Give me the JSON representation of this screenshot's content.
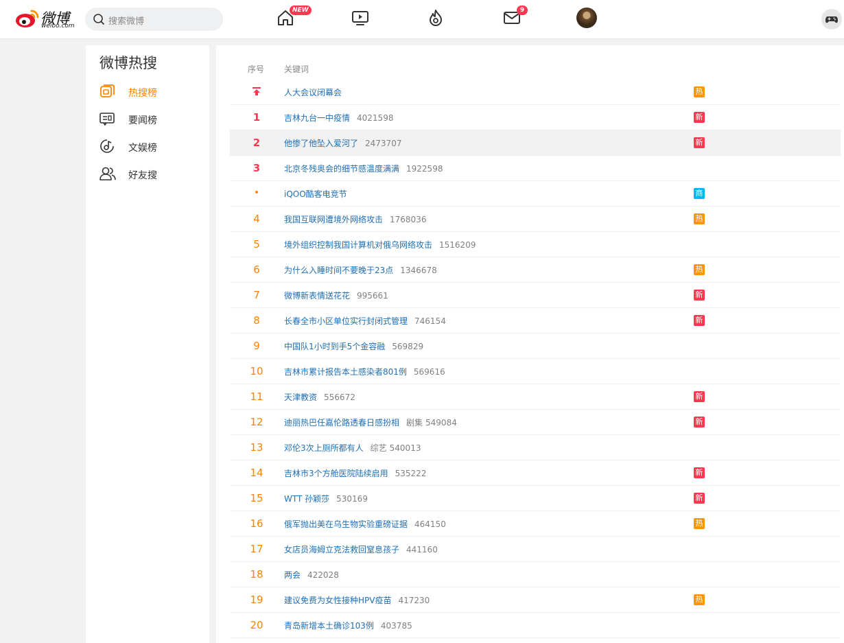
{
  "header": {
    "logo_text": "微博",
    "logo_sub": "weibo.com",
    "search_placeholder": "搜索微博",
    "nav": [
      {
        "icon": "home-icon",
        "badge": "NEW"
      },
      {
        "icon": "video-icon"
      },
      {
        "icon": "hot-flame-icon"
      },
      {
        "icon": "message-icon",
        "badge": "9"
      },
      {
        "icon": "avatar"
      }
    ],
    "badge_new": "NEW",
    "badge_msg": "9"
  },
  "sidebar": {
    "title": "微博热搜",
    "items": [
      {
        "label": "热搜榜",
        "icon": "hot-list-icon",
        "active": true
      },
      {
        "label": "要闻榜",
        "icon": "news-list-icon",
        "active": false
      },
      {
        "label": "文娱榜",
        "icon": "entertainment-icon",
        "active": false
      },
      {
        "label": "好友搜",
        "icon": "friends-icon",
        "active": false
      }
    ]
  },
  "table": {
    "col_rank": "序号",
    "col_keyword": "关键词"
  },
  "rows": [
    {
      "rank": "",
      "kw": "人大会议闭幕会",
      "cat": "",
      "num": "",
      "tag": "热",
      "tagType": "re",
      "rankType": "pin"
    },
    {
      "rank": "1",
      "kw": "吉林九台一中疫情",
      "cat": "",
      "num": "4021598",
      "tag": "新",
      "tagType": "xin",
      "rankType": "top"
    },
    {
      "rank": "2",
      "kw": "他惨了他坠入爱河了",
      "cat": "",
      "num": "2473707",
      "tag": "新",
      "tagType": "xin",
      "rankType": "top",
      "hl": true
    },
    {
      "rank": "3",
      "kw": "北京冬残奥会的细节感温度满满",
      "cat": "",
      "num": "1922598",
      "tag": "",
      "tagType": "",
      "rankType": "top"
    },
    {
      "rank": "•",
      "kw": "iQOO酷客电竞节",
      "cat": "",
      "num": "",
      "tag": "商",
      "tagType": "shang",
      "rankType": "ad"
    },
    {
      "rank": "4",
      "kw": "我国互联网遭境外网络攻击",
      "cat": "",
      "num": "1768036",
      "tag": "热",
      "tagType": "re",
      "rankType": "normal"
    },
    {
      "rank": "5",
      "kw": "境外组织控制我国计算机对俄乌网络攻击",
      "cat": "",
      "num": "1516209",
      "tag": "",
      "tagType": "",
      "rankType": "normal"
    },
    {
      "rank": "6",
      "kw": "为什么入睡时间不要晚于23点",
      "cat": "",
      "num": "1346678",
      "tag": "热",
      "tagType": "re",
      "rankType": "normal"
    },
    {
      "rank": "7",
      "kw": "微博新表情送花花",
      "cat": "",
      "num": "995661",
      "tag": "新",
      "tagType": "xin",
      "rankType": "normal"
    },
    {
      "rank": "8",
      "kw": "长春全市小区单位实行封闭式管理",
      "cat": "",
      "num": "746154",
      "tag": "新",
      "tagType": "xin",
      "rankType": "normal"
    },
    {
      "rank": "9",
      "kw": "中国队1小时到手5个金容融",
      "cat": "",
      "num": "569829",
      "tag": "",
      "tagType": "",
      "rankType": "normal"
    },
    {
      "rank": "10",
      "kw": "吉林市累计报告本土感染者801例",
      "cat": "",
      "num": "569616",
      "tag": "",
      "tagType": "",
      "rankType": "normal"
    },
    {
      "rank": "11",
      "kw": "天津教资",
      "cat": "",
      "num": "556672",
      "tag": "新",
      "tagType": "xin",
      "rankType": "normal"
    },
    {
      "rank": "12",
      "kw": "迪丽热巴任嘉伦路透春日感扮相",
      "cat": "剧集",
      "num": "549084",
      "tag": "新",
      "tagType": "xin",
      "rankType": "normal"
    },
    {
      "rank": "13",
      "kw": "邓伦3次上厕所都有人",
      "cat": "综艺",
      "num": "540013",
      "tag": "",
      "tagType": "",
      "rankType": "normal"
    },
    {
      "rank": "14",
      "kw": "吉林市3个方舱医院陆续启用",
      "cat": "",
      "num": "535222",
      "tag": "新",
      "tagType": "xin",
      "rankType": "normal"
    },
    {
      "rank": "15",
      "kw": "WTT 孙颖莎",
      "cat": "",
      "num": "530169",
      "tag": "新",
      "tagType": "xin",
      "rankType": "normal"
    },
    {
      "rank": "16",
      "kw": "俄军抛出美在乌生物实验重磅证据",
      "cat": "",
      "num": "464150",
      "tag": "热",
      "tagType": "re",
      "rankType": "normal"
    },
    {
      "rank": "17",
      "kw": "女店员海姆立克法救回窒息孩子",
      "cat": "",
      "num": "441160",
      "tag": "",
      "tagType": "",
      "rankType": "normal"
    },
    {
      "rank": "18",
      "kw": "两会",
      "cat": "",
      "num": "422028",
      "tag": "",
      "tagType": "",
      "rankType": "normal"
    },
    {
      "rank": "19",
      "kw": "建议免费为女性接种HPV疫苗",
      "cat": "",
      "num": "417230",
      "tag": "热",
      "tagType": "re",
      "rankType": "normal"
    },
    {
      "rank": "20",
      "kw": "青岛新增本土确诊103例",
      "cat": "",
      "num": "403785",
      "tag": "",
      "tagType": "",
      "rankType": "normal"
    }
  ],
  "colors": {
    "accent": "#ff8200",
    "top_rank": "#ff3852",
    "link": "#1f6fb5",
    "tag_hot": "#ff9406",
    "tag_new": "#ff3852",
    "tag_ad": "#00b7ee"
  }
}
